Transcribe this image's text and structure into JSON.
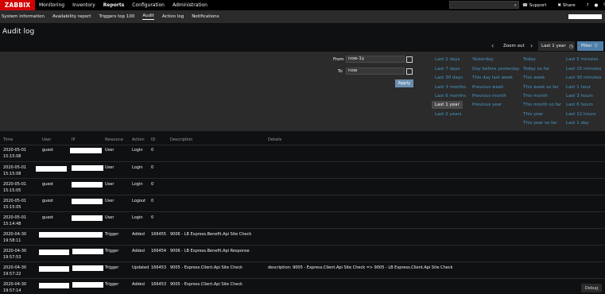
{
  "header": {
    "logo": "ZABBIX",
    "nav": [
      "Monitoring",
      "Inventory",
      "Reports",
      "Configuration",
      "Administration"
    ],
    "active_nav": "Reports",
    "support": "Support",
    "share": "Share",
    "help": "?"
  },
  "subnav": {
    "items": [
      "System information",
      "Availability report",
      "Triggers top 100",
      "Audit",
      "Action log",
      "Notifications"
    ],
    "active": "Audit"
  },
  "page": {
    "title": "Audit log"
  },
  "timebar": {
    "zoom_out": "Zoom out",
    "period": "Last 1 year",
    "filter": "Filter"
  },
  "filter": {
    "from_label": "From",
    "from_value": "now-1y",
    "to_label": "To",
    "to_value": "now",
    "apply": "Apply",
    "quick_col1": [
      "Last 2 days",
      "Last 7 days",
      "Last 30 days",
      "Last 3 months",
      "Last 6 months",
      "Last 1 year",
      "Last 2 years"
    ],
    "quick_col2": [
      "Yesterday",
      "Day before yesterday",
      "This day last week",
      "Previous week",
      "Previous month",
      "Previous year"
    ],
    "quick_col3": [
      "Today",
      "Today so far",
      "This week",
      "This week so far",
      "This month",
      "This month so far",
      "This year",
      "This year so far"
    ],
    "quick_col4": [
      "Last 5 minutes",
      "Last 15 minutes",
      "Last 30 minutes",
      "Last 1 hour",
      "Last 3 hours",
      "Last 6 hours",
      "Last 12 hours",
      "Last 1 day"
    ],
    "selected": "Last 1 year"
  },
  "table": {
    "columns": [
      "Time",
      "User",
      "IP",
      "Resource",
      "Action",
      "ID",
      "Description",
      "Details"
    ],
    "rows": [
      {
        "date": "2020-05-01",
        "time": "15:15:08",
        "user": "guest",
        "resource": "User",
        "action": "Login",
        "id": "0",
        "description": "",
        "details": ""
      },
      {
        "date": "2020-05-01",
        "time": "15:15:08",
        "user": "",
        "resource": "User",
        "action": "Login",
        "id": "0",
        "description": "",
        "details": ""
      },
      {
        "date": "2020-05-01",
        "time": "15:15:05",
        "user": "guest",
        "resource": "User",
        "action": "Login",
        "id": "0",
        "description": "",
        "details": ""
      },
      {
        "date": "2020-05-01",
        "time": "15:15:05",
        "user": "guest",
        "resource": "User",
        "action": "Logout",
        "id": "0",
        "description": "",
        "details": ""
      },
      {
        "date": "2020-05-01",
        "time": "15:14:48",
        "user": "guest",
        "resource": "User",
        "action": "Login",
        "id": "0",
        "description": "",
        "details": ""
      },
      {
        "date": "2020-04-30",
        "time": "19:58:11",
        "user": "",
        "resource": "Trigger",
        "action": "Added",
        "id": "166455",
        "description": "9006 - LB Express.Benefit.Api Site Check",
        "details": ""
      },
      {
        "date": "2020-04-30",
        "time": "19:57:53",
        "user": "",
        "resource": "Trigger",
        "action": "Added",
        "id": "166454",
        "description": "9006 - LB Express.Benefit.Api Response",
        "details": ""
      },
      {
        "date": "2020-04-30",
        "time": "19:57:22",
        "user": "",
        "resource": "Trigger",
        "action": "Updated",
        "id": "166453",
        "description": "9005 - Express.Client.Api Site Check",
        "details": "description: 9005 - Express.Client.Api Site Check => 9005 - LB Express.Client.Api Site Check"
      },
      {
        "date": "2020-04-30",
        "time": "19:57:14",
        "user": "",
        "resource": "Trigger",
        "action": "Added",
        "id": "166453",
        "description": "9005 - Express.Client.Api Site Check",
        "details": ""
      }
    ]
  },
  "footer": {
    "debug": "Debug"
  }
}
